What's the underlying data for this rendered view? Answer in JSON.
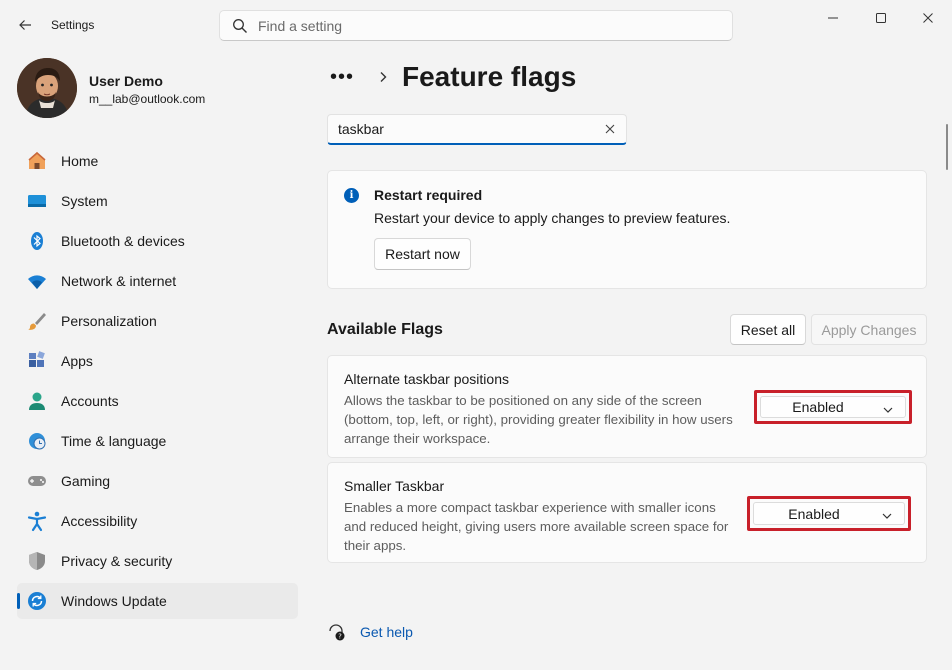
{
  "window": {
    "title": "Settings",
    "search_placeholder": "Find a setting"
  },
  "profile": {
    "name": "User Demo",
    "email": "m__lab@outlook.com"
  },
  "sidebar": {
    "items": [
      {
        "label": "Home",
        "icon": "home-icon"
      },
      {
        "label": "System",
        "icon": "system-icon"
      },
      {
        "label": "Bluetooth & devices",
        "icon": "bluetooth-icon"
      },
      {
        "label": "Network & internet",
        "icon": "wifi-icon"
      },
      {
        "label": "Personalization",
        "icon": "brush-icon"
      },
      {
        "label": "Apps",
        "icon": "apps-icon"
      },
      {
        "label": "Accounts",
        "icon": "accounts-icon"
      },
      {
        "label": "Time & language",
        "icon": "clock-globe-icon"
      },
      {
        "label": "Gaming",
        "icon": "gamepad-icon"
      },
      {
        "label": "Accessibility",
        "icon": "accessibility-icon"
      },
      {
        "label": "Privacy & security",
        "icon": "shield-icon"
      },
      {
        "label": "Windows Update",
        "icon": "update-icon",
        "selected": true
      }
    ]
  },
  "main": {
    "breadcrumb_more": "•••",
    "title": "Feature flags",
    "filter_value": "taskbar",
    "info": {
      "title": "Restart required",
      "text": "Restart your device to apply changes to preview features.",
      "button": "Restart now"
    },
    "section_title": "Available Flags",
    "reset_label": "Reset all",
    "apply_label": "Apply Changes",
    "flags": [
      {
        "title": "Alternate taskbar positions",
        "description": "Allows the taskbar to be positioned on any side of the screen (bottom, top, left, or right), providing greater flexibility in how users arrange their workspace.",
        "value": "Enabled"
      },
      {
        "title": "Smaller Taskbar",
        "description": "Enables a more compact taskbar experience with smaller icons and reduced height, giving users more available screen space for their apps.",
        "value": "Enabled"
      }
    ],
    "help_label": "Get help"
  },
  "colors": {
    "accent": "#005fb8",
    "highlight_outline": "#c8202a",
    "link": "#0a58b0"
  }
}
